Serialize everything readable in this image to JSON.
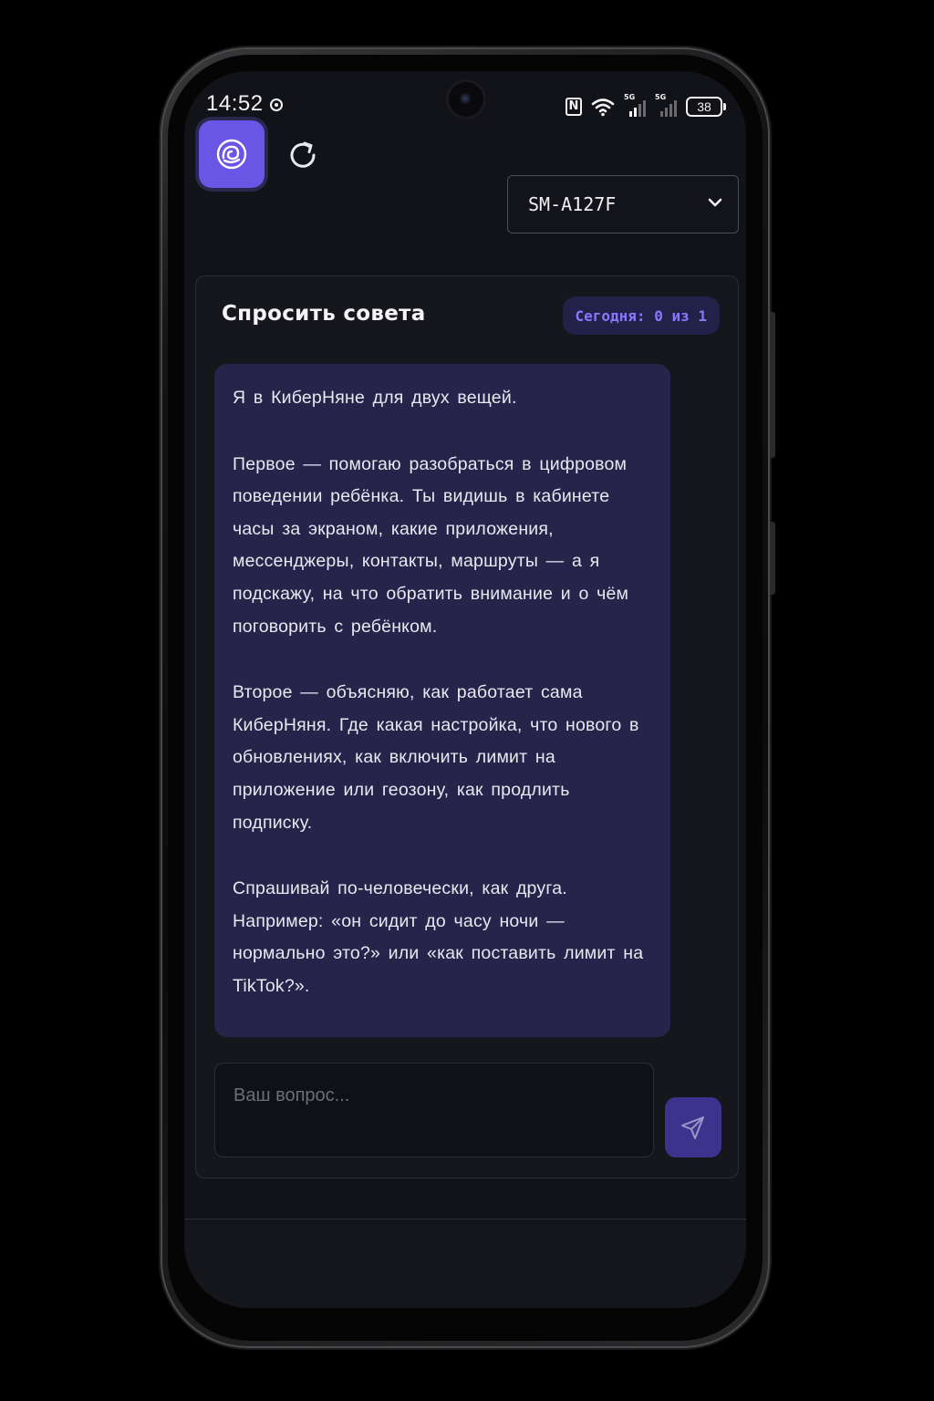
{
  "status_bar": {
    "time": "14:52",
    "battery": "38",
    "icons": [
      "location-icon",
      "nfc-icon",
      "wifi-icon",
      "signal-icon",
      "signal-icon",
      "battery-icon"
    ]
  },
  "header": {
    "logo_icon": "baby-logo-icon",
    "refresh_icon": "refresh-icon",
    "device_select": {
      "value": "SM-A127F",
      "icon": "chevron-down-icon"
    }
  },
  "card": {
    "title": "Спросить совета",
    "quota": "Сегодня: 0 из 1",
    "message": {
      "paragraphs": [
        "Я в КиберНяне для двух вещей.",
        "Первое — помогаю разобраться в цифровом поведении ребёнка. Ты видишь в кабинете часы за экраном, какие приложения, мессенджеры, контакты, маршруты — а я подскажу, на что обратить внимание и о чём поговорить с ребёнком.",
        "Второе — объясняю, как работает сама КиберНяня. Где какая настройка, что нового в обновлениях, как включить лимит на приложение или геозону, как продлить подписку.",
        "Спрашивай по-человечески, как друга. Например: «он сидит до часу ночи — нормально это?» или «как поставить лимит на TikTok?»."
      ]
    },
    "input": {
      "value": "",
      "placeholder": "Ваш вопрос..."
    },
    "send_icon": "send-icon"
  },
  "colors": {
    "accent": "#6a55e6",
    "badge_text": "#8b76ff",
    "bubble": "#26244a",
    "background": "#121318"
  }
}
